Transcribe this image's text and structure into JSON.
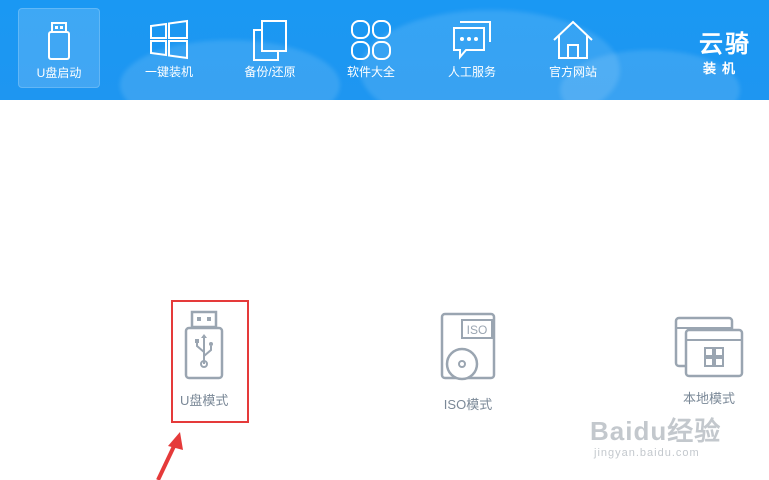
{
  "nav": [
    {
      "label": "U盘启动",
      "icon": "usb-drive-icon"
    },
    {
      "label": "一键装机",
      "icon": "windows-icon"
    },
    {
      "label": "备份/还原",
      "icon": "copy-icon"
    },
    {
      "label": "软件大全",
      "icon": "apps-grid-icon"
    },
    {
      "label": "人工服务",
      "icon": "chat-icon"
    },
    {
      "label": "官方网站",
      "icon": "home-icon"
    }
  ],
  "brand": {
    "title": "云骑",
    "subtitle": "装机"
  },
  "modes": [
    {
      "label": "U盘模式",
      "icon": "usb-drive-icon"
    },
    {
      "label": "ISO模式",
      "icon": "iso-disc-icon",
      "icon_text": "ISO"
    },
    {
      "label": "本地模式",
      "icon": "local-windows-icon"
    }
  ],
  "watermark": {
    "main": "Baidu经验",
    "sub": "jingyan.baidu.com"
  },
  "colors": {
    "header_blue": "#1e96f1",
    "mode_icon_gray": "#9aa5b1",
    "highlight_red": "#e53a3a"
  }
}
